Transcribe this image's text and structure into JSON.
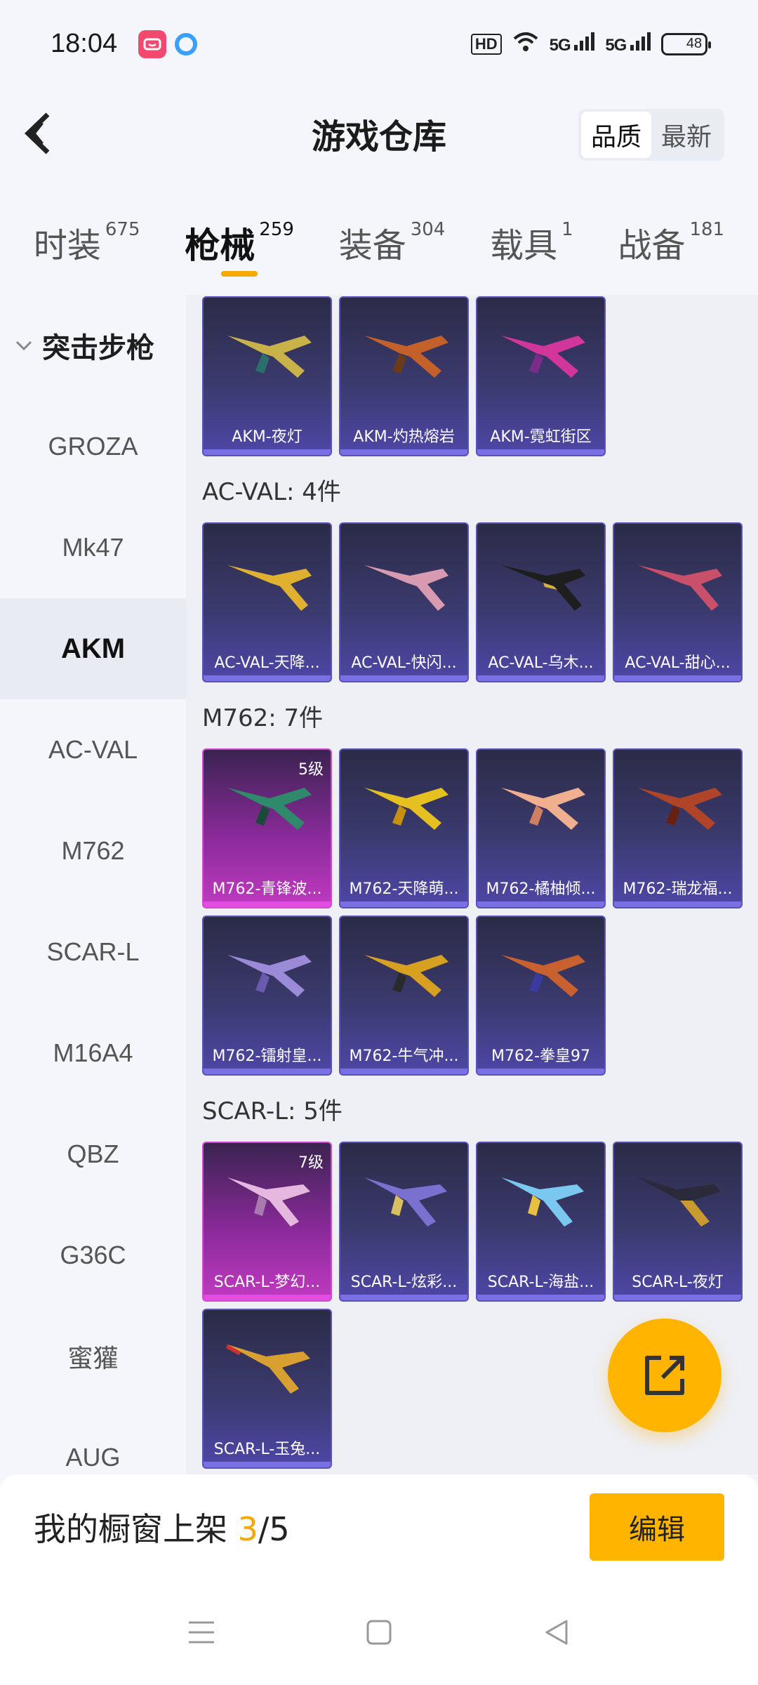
{
  "status_bar": {
    "time": "18:04",
    "network_label": "HD",
    "signal1": "5G",
    "signal2": "5G",
    "battery": "48"
  },
  "header": {
    "title": "游戏仓库",
    "sort_options": [
      "品质",
      "最新"
    ],
    "sort_selected": "品质"
  },
  "tabs": [
    {
      "label": "时装",
      "count": "675"
    },
    {
      "label": "枪械",
      "count": "259"
    },
    {
      "label": "装备",
      "count": "304"
    },
    {
      "label": "载具",
      "count": "1"
    },
    {
      "label": "战备",
      "count": "181"
    }
  ],
  "sidebar": {
    "group": "突击步枪",
    "items": [
      "GROZA",
      "Mk47",
      "AKM",
      "AC-VAL",
      "M762",
      "SCAR-L",
      "M16A4",
      "QBZ",
      "G36C",
      "蜜獾",
      "AUG"
    ],
    "active": "AKM"
  },
  "sections": {
    "akm_items": [
      "AKM-夜灯",
      "AKM-灼热熔岩",
      "AKM-霓虹街区"
    ],
    "acval": {
      "title": "AC-VAL: 4件",
      "items": [
        "AC-VAL-天降...",
        "AC-VAL-快闪...",
        "AC-VAL-乌木...",
        "AC-VAL-甜心..."
      ]
    },
    "m762": {
      "title": "M762: 7件",
      "items": [
        "M762-青锋波...",
        "M762-天降萌...",
        "M762-橘柚倾...",
        "M762-瑞龙福...",
        "M762-镭射皇...",
        "M762-牛气冲...",
        "M762-拳皇97"
      ],
      "level_first": "5级"
    },
    "scarl": {
      "title": "SCAR-L: 5件",
      "items": [
        "SCAR-L-梦幻...",
        "SCAR-L-炫彩...",
        "SCAR-L-海盐...",
        "SCAR-L-夜灯",
        "SCAR-L-玉兔..."
      ],
      "level_first": "7级"
    }
  },
  "bottom_bar": {
    "showcase_label": "我的橱窗上架 ",
    "current": "3",
    "separator": "/",
    "total": "5",
    "edit_label": "编辑"
  },
  "colors": {
    "accent": "#ffb400",
    "underline": "#f4a900",
    "card_purple": "#4e47a8",
    "card_pink": "#c03ac0"
  },
  "icons": [
    "back-icon",
    "chevron-down-icon",
    "share-icon",
    "menu-icon",
    "home-icon",
    "back-nav-icon"
  ]
}
